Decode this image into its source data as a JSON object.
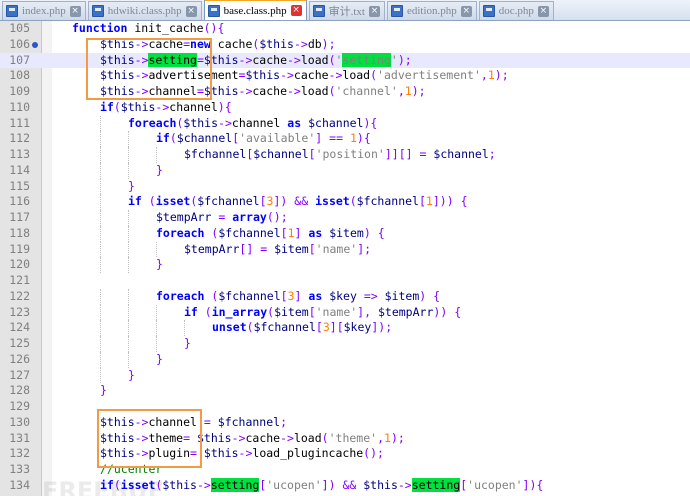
{
  "tabs": [
    {
      "label": "index.php",
      "icon": "php-file-icon",
      "active": false
    },
    {
      "label": "hdwiki.class.php",
      "icon": "php-file-icon",
      "active": false
    },
    {
      "label": "base.class.php",
      "icon": "php-file-icon",
      "active": true
    },
    {
      "label": "审计.txt",
      "icon": "text-file-icon",
      "active": false
    },
    {
      "label": "edition.php",
      "icon": "php-file-icon",
      "active": false
    },
    {
      "label": "doc.php",
      "icon": "php-file-icon",
      "active": false
    }
  ],
  "close_glyph": "×",
  "current_line": 107,
  "bookmark_line": 106,
  "lines": [
    {
      "n": "105",
      "code": "function init_cache(){"
    },
    {
      "n": "106",
      "code": "$this->cache=new cache($this->db);"
    },
    {
      "n": "107",
      "code": "$this->setting=$this->cache->load('setting');"
    },
    {
      "n": "108",
      "code": "$this->advertisement=$this->cache->load('advertisement',1);"
    },
    {
      "n": "109",
      "code": "$this->channel=$this->cache->load('channel',1);"
    },
    {
      "n": "110",
      "code": "if($this->channel){"
    },
    {
      "n": "111",
      "code": "foreach($this->channel as $channel){"
    },
    {
      "n": "112",
      "code": "if($channel['available'] == 1){"
    },
    {
      "n": "113",
      "code": "$fchannel[$channel['position']][] = $channel;"
    },
    {
      "n": "114",
      "code": "}"
    },
    {
      "n": "115",
      "code": "}"
    },
    {
      "n": "116",
      "code": "if (isset($fchannel[3]) && isset($fchannel[1])) {"
    },
    {
      "n": "117",
      "code": "$tempArr = array();"
    },
    {
      "n": "118",
      "code": "foreach ($fchannel[1] as $item) {"
    },
    {
      "n": "119",
      "code": "$tempArr[] = $item['name'];"
    },
    {
      "n": "120",
      "code": "}"
    },
    {
      "n": "121",
      "code": ""
    },
    {
      "n": "122",
      "code": "foreach ($fchannel[3] as $key => $item) {"
    },
    {
      "n": "123",
      "code": "if (in_array($item['name'], $tempArr)) {"
    },
    {
      "n": "124",
      "code": "unset($fchannel[3][$key]);"
    },
    {
      "n": "125",
      "code": "}"
    },
    {
      "n": "126",
      "code": "}"
    },
    {
      "n": "127",
      "code": "}"
    },
    {
      "n": "128",
      "code": "}"
    },
    {
      "n": "129",
      "code": ""
    },
    {
      "n": "130",
      "code": "$this->channel = $fchannel;"
    },
    {
      "n": "131",
      "code": "$this->theme= $this->cache->load('theme',1);"
    },
    {
      "n": "132",
      "code": "$this->plugin= $this->load_plugincache();"
    },
    {
      "n": "133",
      "code": "//ucenter"
    },
    {
      "n": "134",
      "code": "if(isset($this->setting['ucopen']) && $this->setting['ucopen']){"
    }
  ],
  "watermark": "FREEBUF",
  "colors": {
    "keyword": "#0000ff",
    "operator": "#8000ff",
    "string": "#808080",
    "variable": "#000080",
    "number": "#ff8000",
    "comment": "#008000",
    "search_highlight": "#00e040",
    "annotation_box": "#f39a45",
    "current_line": "#e8e8ff"
  }
}
